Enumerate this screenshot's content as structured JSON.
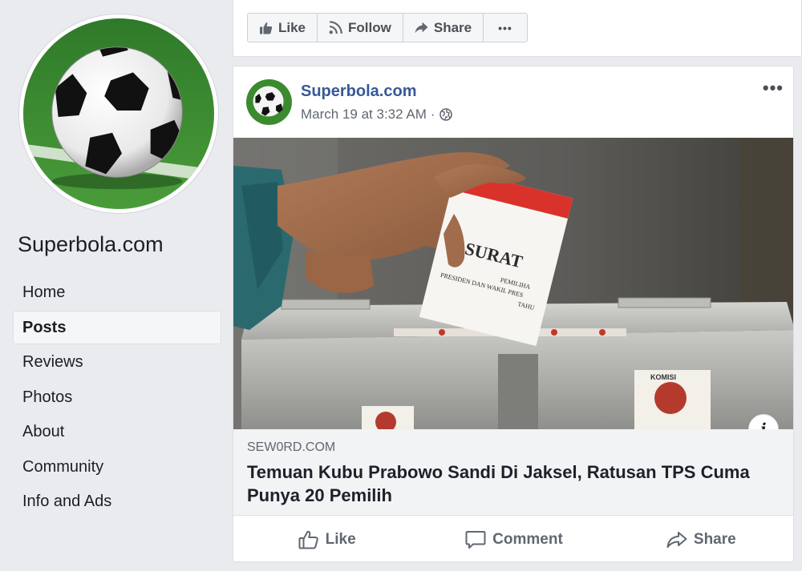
{
  "sidebar": {
    "page_name": "Superbola.com",
    "nav": [
      "Home",
      "Posts",
      "Reviews",
      "Photos",
      "About",
      "Community",
      "Info and Ads"
    ],
    "active": "Posts"
  },
  "topbar": {
    "like": "Like",
    "follow": "Follow",
    "share": "Share",
    "more": "•••"
  },
  "post": {
    "author": "Superbola.com",
    "date": "March 19 at 3:32 AM",
    "separator": "·",
    "more": "•••",
    "image_text": {
      "ballot_title": "SURAT",
      "ballot_line1": "PEMILIHA",
      "ballot_line2": "PRESIDEN DAN WAKIL PRES",
      "ballot_line3": "TAHU",
      "box_label": "KOMISI"
    },
    "info_icon": "i",
    "link": {
      "domain": "SEW0RD.COM",
      "title": "Temuan Kubu Prabowo Sandi Di Jaksel, Ratusan TPS Cuma Punya 20 Pemilih"
    },
    "actions": {
      "like": "Like",
      "comment": "Comment",
      "share": "Share"
    }
  },
  "colors": {
    "background": "#e9ebee",
    "link_blue": "#385898",
    "grass": "#3b8a2f",
    "ballot_red": "#d9322b"
  }
}
